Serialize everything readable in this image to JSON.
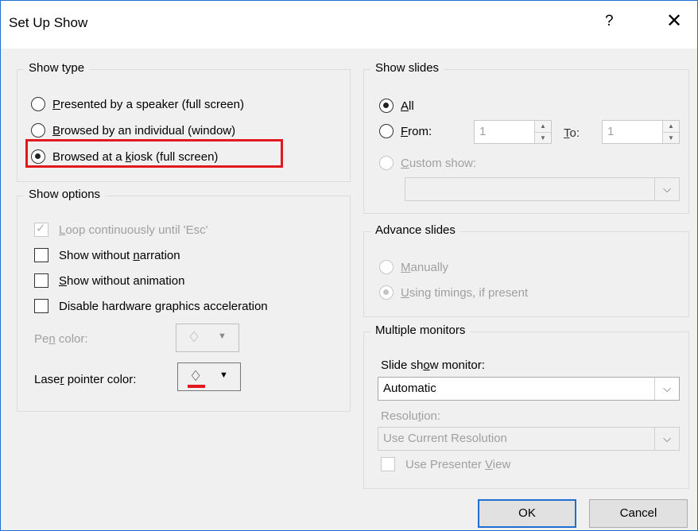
{
  "title": "Set Up Show",
  "help_label": "?",
  "close_label": "✕",
  "show_type": {
    "label": "Show type",
    "options": [
      {
        "pre": "",
        "key": "P",
        "post": "resented by a speaker (full screen)",
        "selected": false
      },
      {
        "pre": "",
        "key": "B",
        "post": "rowsed by an individual (window)",
        "selected": false
      },
      {
        "pre": "Browsed at a ",
        "key": "k",
        "post": "iosk (full screen)",
        "selected": true
      }
    ]
  },
  "show_options": {
    "label": "Show options",
    "loop": {
      "pre": "",
      "key": "L",
      "post": "oop continuously until 'Esc'",
      "checked": true,
      "disabled": true
    },
    "narration": {
      "pre": "Show without ",
      "key": "n",
      "post": "arration",
      "checked": false
    },
    "animation": {
      "pre": "",
      "key": "S",
      "post": "how without animation",
      "checked": false
    },
    "hardware": {
      "pre": "Disable hardware ",
      "key": "g",
      "post": "raphics acceleration",
      "checked": false
    },
    "pen_color": {
      "pre": "Pe",
      "key": "n",
      "post": " color:"
    },
    "laser_color": {
      "pre": "Lase",
      "key": "r",
      "post": " pointer color:"
    },
    "laser_swatch": "#e0191f"
  },
  "show_slides": {
    "label": "Show slides",
    "all": {
      "pre": "",
      "key": "A",
      "post": "ll",
      "selected": true
    },
    "from": {
      "pre": "",
      "key": "F",
      "post": "rom:",
      "selected": false,
      "value": "1"
    },
    "to": {
      "pre": "",
      "key": "T",
      "post": "o:",
      "value": "1"
    },
    "custom": {
      "pre": "",
      "key": "C",
      "post": "ustom show:",
      "selected": false,
      "value": ""
    }
  },
  "advance_slides": {
    "label": "Advance slides",
    "manually": {
      "pre": "",
      "key": "M",
      "post": "anually",
      "selected": false
    },
    "timings": {
      "pre": "",
      "key": "U",
      "post": "sing timings, if present",
      "selected": true
    }
  },
  "multiple_monitors": {
    "label": "Multiple monitors",
    "monitor_label": {
      "pre": "Slide sh",
      "key": "o",
      "post": "w monitor:"
    },
    "monitor_value": "Automatic",
    "resolution_label": {
      "pre": "Resolu",
      "key": "t",
      "post": "ion:"
    },
    "resolution_value": "Use Current Resolution",
    "presenter": {
      "pre": "Use Presenter ",
      "key": "V",
      "post": "iew",
      "checked": false
    }
  },
  "buttons": {
    "ok": "OK",
    "cancel": "Cancel"
  }
}
